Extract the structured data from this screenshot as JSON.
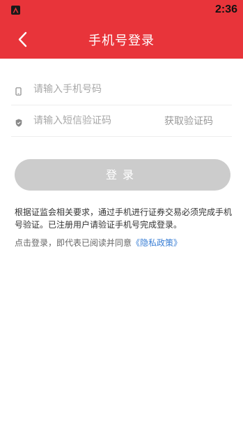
{
  "status_bar": {
    "time": "2:36"
  },
  "header": {
    "title": "手机号登录"
  },
  "form": {
    "phone_placeholder": "请输入手机号码",
    "code_placeholder": "请输入短信验证码",
    "get_code_label": "获取验证码"
  },
  "login_button": {
    "label": "登录"
  },
  "notice": {
    "text": "根据证监会相关要求，通过手机进行证券交易必须完成手机号验证。已注册用户请验证手机号完成登录。"
  },
  "agreement": {
    "prefix": "点击登录，即代表已阅读并同意",
    "link_label": "《隐私政策》"
  },
  "colors": {
    "brand": "#e8343a",
    "button_disabled": "#cccccc",
    "link": "#3a7fd5"
  }
}
